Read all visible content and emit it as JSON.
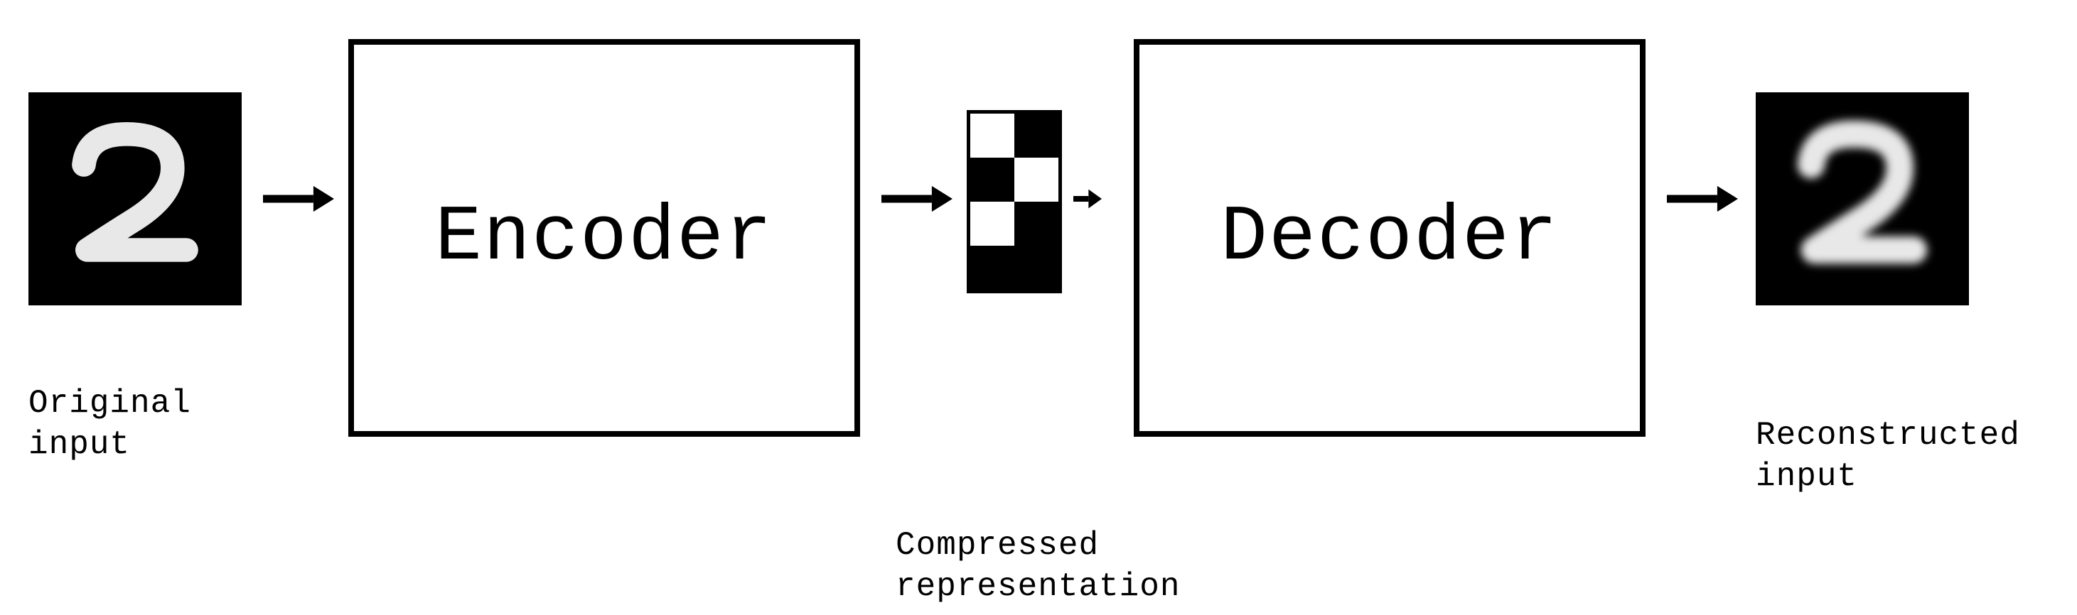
{
  "diagram": {
    "input_caption": "Original\ninput",
    "encoder_label": "Encoder",
    "latent_caption": "Compressed\nrepresentation",
    "decoder_label": "Decoder",
    "output_caption": "Reconstructed\ninput",
    "latent_pattern": [
      "w",
      "b",
      "b",
      "w",
      "w",
      "b",
      "b",
      "b"
    ],
    "digit_shown": "2"
  }
}
